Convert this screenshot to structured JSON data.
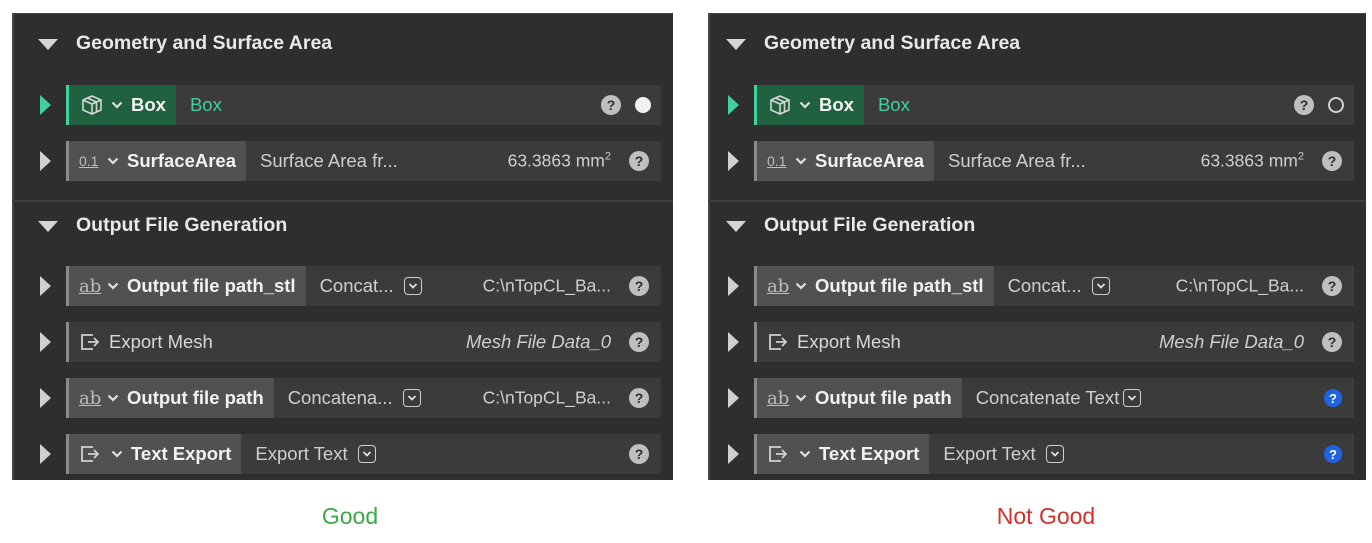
{
  "panels": [
    {
      "id": "good",
      "sections": [
        {
          "title": "Geometry and Surface Area"
        },
        {
          "title": "Output File Generation"
        }
      ],
      "rows": [
        {
          "type_icon": "box-geometry-icon",
          "chip_label": "Box",
          "value_text": "Box",
          "status_dot": "filled",
          "help": "?"
        },
        {
          "type_icon_text": "0.1",
          "chip_label": "SurfaceArea",
          "value_text": "Surface Area fr...",
          "right_value": "63.3863 mm",
          "right_sup": "2",
          "help": "?"
        },
        {
          "type_icon_text": "ab",
          "chip_label": "Output file path_stl",
          "value_text": "Concat...",
          "right_value": "C:\\nTopCL_Ba...",
          "help": "?"
        },
        {
          "type_icon": "export-icon",
          "chip_label": "Export Mesh",
          "right_value": "Mesh File Data_0",
          "help": "?"
        },
        {
          "type_icon_text": "ab",
          "chip_label": "Output file path",
          "value_text": "Concatena...",
          "right_value": "C:\\nTopCL_Ba...",
          "help": "?"
        },
        {
          "type_icon": "export-icon",
          "chip_label": "Text Export",
          "value_text": "Export Text",
          "help": "?"
        }
      ],
      "caption": "Good",
      "caption_color": "#3aa847"
    },
    {
      "id": "not-good",
      "sections": [
        {
          "title": "Geometry and Surface Area"
        },
        {
          "title": "Output File Generation"
        }
      ],
      "rows": [
        {
          "type_icon": "box-geometry-icon",
          "chip_label": "Box",
          "value_text": "Box",
          "status_dot": "ring",
          "help": "?"
        },
        {
          "type_icon_text": "0.1",
          "chip_label": "SurfaceArea",
          "value_text": "Surface Area fr...",
          "right_value": "63.3863 mm",
          "right_sup": "2",
          "help": "?"
        },
        {
          "type_icon_text": "ab",
          "chip_label": "Output file path_stl",
          "value_text": "Concat...",
          "right_value": "C:\\nTopCL_Ba...",
          "help": "?"
        },
        {
          "type_icon": "export-icon",
          "chip_label": "Export Mesh",
          "right_value": "Mesh File Data_0",
          "help": "?"
        },
        {
          "type_icon_text": "ab",
          "chip_label": "Output file path",
          "value_text": "Concatenate Text",
          "help": "?",
          "help_color": "#1f63e0"
        },
        {
          "type_icon": "export-icon",
          "chip_label": "Text Export",
          "value_text": "Export Text",
          "help": "?",
          "help_color": "#1f63e0"
        }
      ],
      "caption": "Not Good",
      "caption_color": "#d0332b"
    }
  ],
  "colors": {
    "panel_bg": "#2e2e2e",
    "row_bg": "#3b3b3b",
    "chip_bg": "#515151",
    "active_green": "#3fd09e",
    "active_chip_bg": "#20613f"
  }
}
